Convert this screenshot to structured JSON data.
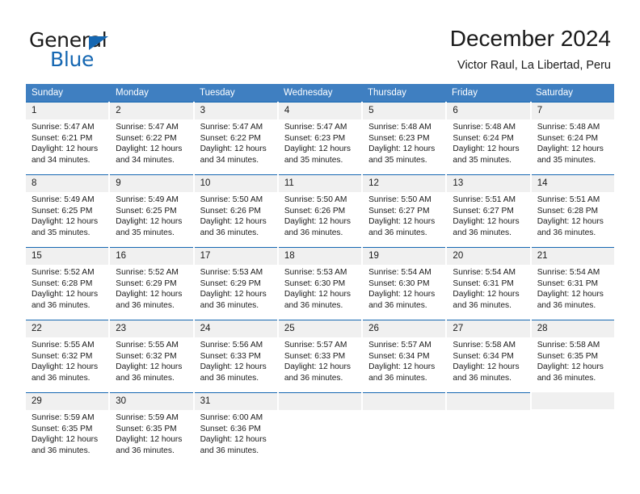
{
  "brand": {
    "name_part1": "General",
    "name_part2": "Blue"
  },
  "header": {
    "title": "December 2024",
    "subtitle": "Victor Raul, La Libertad, Peru"
  },
  "colors": {
    "header_blue": "#3f7fc1",
    "border_blue": "#1567b2",
    "daynum_background": "#f0f0f0",
    "text": "#1a1a1a"
  },
  "weekdays": [
    "Sunday",
    "Monday",
    "Tuesday",
    "Wednesday",
    "Thursday",
    "Friday",
    "Saturday"
  ],
  "labels": {
    "sunrise": "Sunrise:",
    "sunset": "Sunset:",
    "daylight": "Daylight:"
  },
  "weeks": [
    [
      {
        "day": "1",
        "sunrise": "Sunrise: 5:47 AM",
        "sunset": "Sunset: 6:21 PM",
        "daylight_line1": "Daylight: 12 hours",
        "daylight_line2": "and 34 minutes."
      },
      {
        "day": "2",
        "sunrise": "Sunrise: 5:47 AM",
        "sunset": "Sunset: 6:22 PM",
        "daylight_line1": "Daylight: 12 hours",
        "daylight_line2": "and 34 minutes."
      },
      {
        "day": "3",
        "sunrise": "Sunrise: 5:47 AM",
        "sunset": "Sunset: 6:22 PM",
        "daylight_line1": "Daylight: 12 hours",
        "daylight_line2": "and 34 minutes."
      },
      {
        "day": "4",
        "sunrise": "Sunrise: 5:47 AM",
        "sunset": "Sunset: 6:23 PM",
        "daylight_line1": "Daylight: 12 hours",
        "daylight_line2": "and 35 minutes."
      },
      {
        "day": "5",
        "sunrise": "Sunrise: 5:48 AM",
        "sunset": "Sunset: 6:23 PM",
        "daylight_line1": "Daylight: 12 hours",
        "daylight_line2": "and 35 minutes."
      },
      {
        "day": "6",
        "sunrise": "Sunrise: 5:48 AM",
        "sunset": "Sunset: 6:24 PM",
        "daylight_line1": "Daylight: 12 hours",
        "daylight_line2": "and 35 minutes."
      },
      {
        "day": "7",
        "sunrise": "Sunrise: 5:48 AM",
        "sunset": "Sunset: 6:24 PM",
        "daylight_line1": "Daylight: 12 hours",
        "daylight_line2": "and 35 minutes."
      }
    ],
    [
      {
        "day": "8",
        "sunrise": "Sunrise: 5:49 AM",
        "sunset": "Sunset: 6:25 PM",
        "daylight_line1": "Daylight: 12 hours",
        "daylight_line2": "and 35 minutes."
      },
      {
        "day": "9",
        "sunrise": "Sunrise: 5:49 AM",
        "sunset": "Sunset: 6:25 PM",
        "daylight_line1": "Daylight: 12 hours",
        "daylight_line2": "and 35 minutes."
      },
      {
        "day": "10",
        "sunrise": "Sunrise: 5:50 AM",
        "sunset": "Sunset: 6:26 PM",
        "daylight_line1": "Daylight: 12 hours",
        "daylight_line2": "and 36 minutes."
      },
      {
        "day": "11",
        "sunrise": "Sunrise: 5:50 AM",
        "sunset": "Sunset: 6:26 PM",
        "daylight_line1": "Daylight: 12 hours",
        "daylight_line2": "and 36 minutes."
      },
      {
        "day": "12",
        "sunrise": "Sunrise: 5:50 AM",
        "sunset": "Sunset: 6:27 PM",
        "daylight_line1": "Daylight: 12 hours",
        "daylight_line2": "and 36 minutes."
      },
      {
        "day": "13",
        "sunrise": "Sunrise: 5:51 AM",
        "sunset": "Sunset: 6:27 PM",
        "daylight_line1": "Daylight: 12 hours",
        "daylight_line2": "and 36 minutes."
      },
      {
        "day": "14",
        "sunrise": "Sunrise: 5:51 AM",
        "sunset": "Sunset: 6:28 PM",
        "daylight_line1": "Daylight: 12 hours",
        "daylight_line2": "and 36 minutes."
      }
    ],
    [
      {
        "day": "15",
        "sunrise": "Sunrise: 5:52 AM",
        "sunset": "Sunset: 6:28 PM",
        "daylight_line1": "Daylight: 12 hours",
        "daylight_line2": "and 36 minutes."
      },
      {
        "day": "16",
        "sunrise": "Sunrise: 5:52 AM",
        "sunset": "Sunset: 6:29 PM",
        "daylight_line1": "Daylight: 12 hours",
        "daylight_line2": "and 36 minutes."
      },
      {
        "day": "17",
        "sunrise": "Sunrise: 5:53 AM",
        "sunset": "Sunset: 6:29 PM",
        "daylight_line1": "Daylight: 12 hours",
        "daylight_line2": "and 36 minutes."
      },
      {
        "day": "18",
        "sunrise": "Sunrise: 5:53 AM",
        "sunset": "Sunset: 6:30 PM",
        "daylight_line1": "Daylight: 12 hours",
        "daylight_line2": "and 36 minutes."
      },
      {
        "day": "19",
        "sunrise": "Sunrise: 5:54 AM",
        "sunset": "Sunset: 6:30 PM",
        "daylight_line1": "Daylight: 12 hours",
        "daylight_line2": "and 36 minutes."
      },
      {
        "day": "20",
        "sunrise": "Sunrise: 5:54 AM",
        "sunset": "Sunset: 6:31 PM",
        "daylight_line1": "Daylight: 12 hours",
        "daylight_line2": "and 36 minutes."
      },
      {
        "day": "21",
        "sunrise": "Sunrise: 5:54 AM",
        "sunset": "Sunset: 6:31 PM",
        "daylight_line1": "Daylight: 12 hours",
        "daylight_line2": "and 36 minutes."
      }
    ],
    [
      {
        "day": "22",
        "sunrise": "Sunrise: 5:55 AM",
        "sunset": "Sunset: 6:32 PM",
        "daylight_line1": "Daylight: 12 hours",
        "daylight_line2": "and 36 minutes."
      },
      {
        "day": "23",
        "sunrise": "Sunrise: 5:55 AM",
        "sunset": "Sunset: 6:32 PM",
        "daylight_line1": "Daylight: 12 hours",
        "daylight_line2": "and 36 minutes."
      },
      {
        "day": "24",
        "sunrise": "Sunrise: 5:56 AM",
        "sunset": "Sunset: 6:33 PM",
        "daylight_line1": "Daylight: 12 hours",
        "daylight_line2": "and 36 minutes."
      },
      {
        "day": "25",
        "sunrise": "Sunrise: 5:57 AM",
        "sunset": "Sunset: 6:33 PM",
        "daylight_line1": "Daylight: 12 hours",
        "daylight_line2": "and 36 minutes."
      },
      {
        "day": "26",
        "sunrise": "Sunrise: 5:57 AM",
        "sunset": "Sunset: 6:34 PM",
        "daylight_line1": "Daylight: 12 hours",
        "daylight_line2": "and 36 minutes."
      },
      {
        "day": "27",
        "sunrise": "Sunrise: 5:58 AM",
        "sunset": "Sunset: 6:34 PM",
        "daylight_line1": "Daylight: 12 hours",
        "daylight_line2": "and 36 minutes."
      },
      {
        "day": "28",
        "sunrise": "Sunrise: 5:58 AM",
        "sunset": "Sunset: 6:35 PM",
        "daylight_line1": "Daylight: 12 hours",
        "daylight_line2": "and 36 minutes."
      }
    ],
    [
      {
        "day": "29",
        "sunrise": "Sunrise: 5:59 AM",
        "sunset": "Sunset: 6:35 PM",
        "daylight_line1": "Daylight: 12 hours",
        "daylight_line2": "and 36 minutes."
      },
      {
        "day": "30",
        "sunrise": "Sunrise: 5:59 AM",
        "sunset": "Sunset: 6:35 PM",
        "daylight_line1": "Daylight: 12 hours",
        "daylight_line2": "and 36 minutes."
      },
      {
        "day": "31",
        "sunrise": "Sunrise: 6:00 AM",
        "sunset": "Sunset: 6:36 PM",
        "daylight_line1": "Daylight: 12 hours",
        "daylight_line2": "and 36 minutes."
      },
      {
        "day": "",
        "sunrise": "",
        "sunset": "",
        "daylight_line1": "",
        "daylight_line2": ""
      },
      {
        "day": "",
        "sunrise": "",
        "sunset": "",
        "daylight_line1": "",
        "daylight_line2": ""
      },
      {
        "day": "",
        "sunrise": "",
        "sunset": "",
        "daylight_line1": "",
        "daylight_line2": ""
      },
      {
        "day": "",
        "sunrise": "",
        "sunset": "",
        "daylight_line1": "",
        "daylight_line2": ""
      }
    ]
  ]
}
